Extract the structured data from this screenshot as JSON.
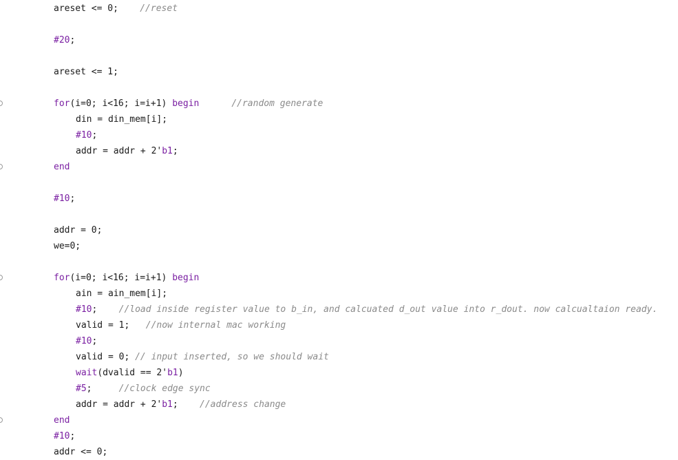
{
  "colors": {
    "keyword": "#7a1fa2",
    "comment": "#8a8a8a",
    "text": "#1a1a1a",
    "background": "#ffffff"
  },
  "lines": [
    {
      "indent": 1,
      "fold": false,
      "tokens": [
        {
          "t": "tx",
          "s": "areset <= 0;    "
        },
        {
          "t": "cm",
          "s": "//reset"
        }
      ]
    },
    {
      "indent": 0,
      "fold": false,
      "tokens": []
    },
    {
      "indent": 1,
      "fold": false,
      "tokens": [
        {
          "t": "kw",
          "s": "#20"
        },
        {
          "t": "tx",
          "s": ";"
        }
      ]
    },
    {
      "indent": 0,
      "fold": false,
      "tokens": []
    },
    {
      "indent": 1,
      "fold": false,
      "tokens": [
        {
          "t": "tx",
          "s": "areset <= 1;"
        }
      ]
    },
    {
      "indent": 0,
      "fold": false,
      "tokens": []
    },
    {
      "indent": 1,
      "fold": true,
      "tokens": [
        {
          "t": "kw",
          "s": "for"
        },
        {
          "t": "tx",
          "s": "(i=0; i<16; i=i+1) "
        },
        {
          "t": "kw",
          "s": "begin"
        },
        {
          "t": "tx",
          "s": "      "
        },
        {
          "t": "cm",
          "s": "//random generate"
        }
      ]
    },
    {
      "indent": 2,
      "fold": false,
      "tokens": [
        {
          "t": "tx",
          "s": "din = din_mem[i];"
        }
      ]
    },
    {
      "indent": 2,
      "fold": false,
      "tokens": [
        {
          "t": "kw",
          "s": "#10"
        },
        {
          "t": "tx",
          "s": ";"
        }
      ]
    },
    {
      "indent": 2,
      "fold": false,
      "tokens": [
        {
          "t": "tx",
          "s": "addr = addr + 2'"
        },
        {
          "t": "num",
          "s": "b1"
        },
        {
          "t": "tx",
          "s": ";"
        }
      ]
    },
    {
      "indent": 1,
      "fold": true,
      "tokens": [
        {
          "t": "kw",
          "s": "end"
        }
      ]
    },
    {
      "indent": 0,
      "fold": false,
      "tokens": []
    },
    {
      "indent": 1,
      "fold": false,
      "tokens": [
        {
          "t": "kw",
          "s": "#10"
        },
        {
          "t": "tx",
          "s": ";"
        }
      ]
    },
    {
      "indent": 0,
      "fold": false,
      "tokens": []
    },
    {
      "indent": 1,
      "fold": false,
      "tokens": [
        {
          "t": "tx",
          "s": "addr = 0;"
        }
      ]
    },
    {
      "indent": 1,
      "fold": false,
      "tokens": [
        {
          "t": "tx",
          "s": "we=0;"
        }
      ]
    },
    {
      "indent": 0,
      "fold": false,
      "tokens": []
    },
    {
      "indent": 1,
      "fold": true,
      "tokens": [
        {
          "t": "kw",
          "s": "for"
        },
        {
          "t": "tx",
          "s": "(i=0; i<16; i=i+1) "
        },
        {
          "t": "kw",
          "s": "begin"
        }
      ]
    },
    {
      "indent": 2,
      "fold": false,
      "tokens": [
        {
          "t": "tx",
          "s": "ain = ain_mem[i];"
        }
      ]
    },
    {
      "indent": 2,
      "fold": false,
      "tokens": [
        {
          "t": "kw",
          "s": "#10"
        },
        {
          "t": "tx",
          "s": ";    "
        },
        {
          "t": "cm",
          "s": "//load inside register value to b_in, and calcuated d_out value into r_dout. now calcualtaion ready."
        }
      ]
    },
    {
      "indent": 2,
      "fold": false,
      "tokens": [
        {
          "t": "tx",
          "s": "valid = 1;   "
        },
        {
          "t": "cm",
          "s": "//now internal mac working"
        }
      ]
    },
    {
      "indent": 2,
      "fold": false,
      "tokens": [
        {
          "t": "kw",
          "s": "#10"
        },
        {
          "t": "tx",
          "s": ";"
        }
      ]
    },
    {
      "indent": 2,
      "fold": false,
      "tokens": [
        {
          "t": "tx",
          "s": "valid = 0; "
        },
        {
          "t": "cm",
          "s": "// input inserted, so we should wait"
        }
      ]
    },
    {
      "indent": 2,
      "fold": false,
      "tokens": [
        {
          "t": "kw",
          "s": "wait"
        },
        {
          "t": "tx",
          "s": "(dvalid == 2'"
        },
        {
          "t": "num",
          "s": "b1"
        },
        {
          "t": "tx",
          "s": ")"
        }
      ]
    },
    {
      "indent": 2,
      "fold": false,
      "tokens": [
        {
          "t": "kw",
          "s": "#5"
        },
        {
          "t": "tx",
          "s": ";     "
        },
        {
          "t": "cm",
          "s": "//clock edge sync"
        }
      ]
    },
    {
      "indent": 2,
      "fold": false,
      "tokens": [
        {
          "t": "tx",
          "s": "addr = addr + 2'"
        },
        {
          "t": "num",
          "s": "b1"
        },
        {
          "t": "tx",
          "s": ";    "
        },
        {
          "t": "cm",
          "s": "//address change"
        }
      ]
    },
    {
      "indent": 1,
      "fold": true,
      "tokens": [
        {
          "t": "kw",
          "s": "end"
        }
      ]
    },
    {
      "indent": 1,
      "fold": false,
      "tokens": [
        {
          "t": "kw",
          "s": "#10"
        },
        {
          "t": "tx",
          "s": ";"
        }
      ]
    },
    {
      "indent": 1,
      "fold": false,
      "tokens": [
        {
          "t": "tx",
          "s": "addr <= 0;"
        }
      ]
    }
  ]
}
